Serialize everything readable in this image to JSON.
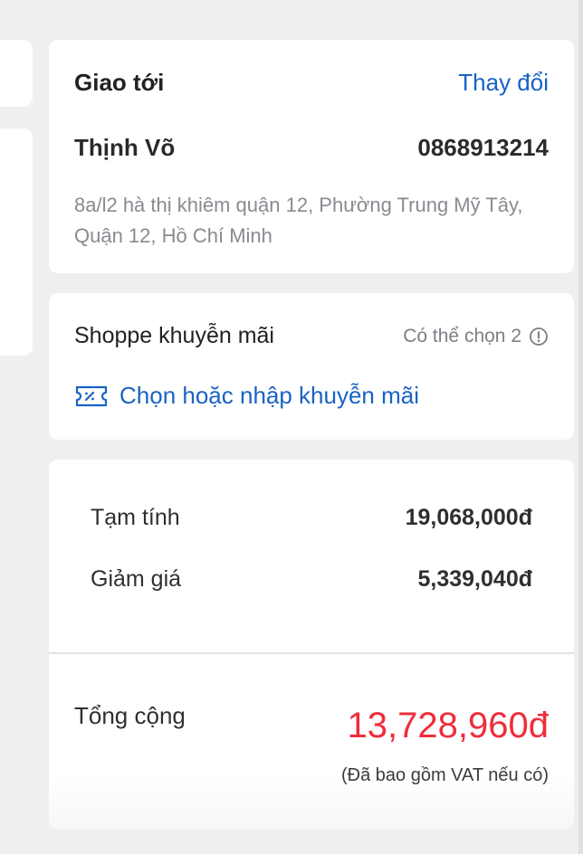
{
  "shipping": {
    "title": "Giao tới",
    "change_label": "Thay đổi",
    "recipient_name": "Thịnh Võ",
    "phone": "0868913214",
    "address": "8a/l2 hà thị khiêm quận 12, Phường Trung Mỹ Tây, Quận 12, Hồ Chí Minh"
  },
  "promo": {
    "title": "Shoppe khuyễn mãi",
    "hint": "Có thể chọn 2",
    "action_label": "Chọn hoặc nhập khuyễn mãi",
    "info_icon": "info-icon",
    "ticket_icon": "ticket-icon"
  },
  "summary": {
    "subtotal_label": "Tạm tính",
    "subtotal_value": "19,068,000đ",
    "discount_label": "Giảm giá",
    "discount_value": "5,339,040đ",
    "total_label": "Tổng cộng",
    "total_value": "13,728,960đ",
    "vat_note": "(Đã bao gồm VAT nếu có)"
  },
  "colors": {
    "accent_blue": "#1a62c4",
    "total_red": "#ef2d3a",
    "background": "#efeff0"
  }
}
